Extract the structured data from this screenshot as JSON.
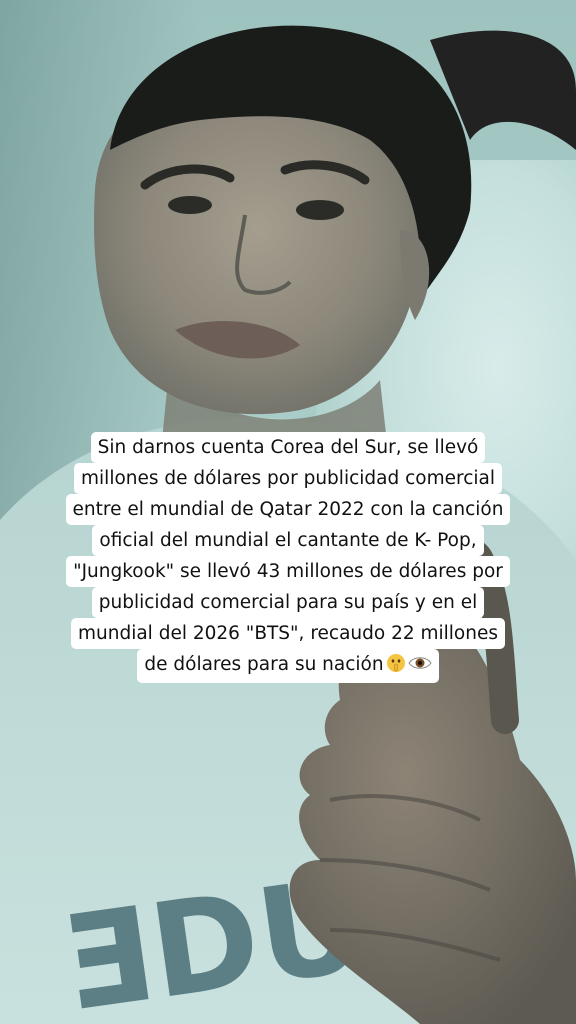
{
  "caption": {
    "lines": [
      "Sin darnos cuenta Corea del Sur, se llevó",
      "millones de dólares por publicidad comercial",
      "entre el mundial de Qatar 2022 con la canción",
      "oficial del mundial el cantante de K- Pop,",
      "\"Jungkook\" se llevó 43 millones de dólares por",
      "publicidad comercial para su país y en el",
      "mundial del 2026 \"BTS\", recaudo 22 millones",
      "de dólares para su nación"
    ],
    "emojis": [
      "shushing-face-emoji",
      "eye-emoji"
    ]
  },
  "shirt_print": "ƎDU"
}
